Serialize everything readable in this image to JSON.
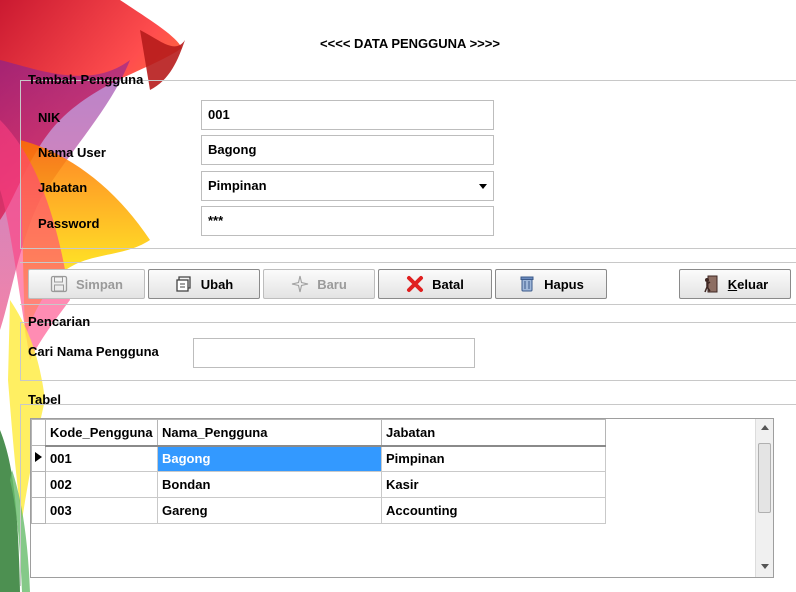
{
  "window": {
    "title": "<<<< DATA PENGGUNA >>>>"
  },
  "tambah": {
    "legend": "Tambah Pengguna",
    "nik_label": "NIK",
    "nik_value": "001",
    "nama_label": "Nama User",
    "nama_value": "Bagong",
    "jabatan_label": "Jabatan",
    "jabatan_value": "Pimpinan",
    "password_label": "Password",
    "password_value": "***"
  },
  "toolbar": {
    "simpan": "Simpan",
    "ubah": "Ubah",
    "baru": "Baru",
    "batal": "Batal",
    "hapus": "Hapus",
    "keluar_k": "K",
    "keluar_rest": "eluar"
  },
  "pencarian": {
    "legend": "Pencarian",
    "label": "Cari Nama Pengguna",
    "value": ""
  },
  "tabel": {
    "legend": "Tabel",
    "columns": [
      "Kode_Pengguna",
      "Nama_Pengguna",
      "Jabatan"
    ],
    "rows": [
      [
        "001",
        "Bagong",
        "Pimpinan"
      ],
      [
        "002",
        "Bondan",
        "Kasir"
      ],
      [
        "003",
        "Gareng",
        "Accounting"
      ]
    ]
  },
  "colors": {
    "selection": "#3399ff",
    "cancel_icon": "#e02020",
    "background": "#ffffff"
  }
}
